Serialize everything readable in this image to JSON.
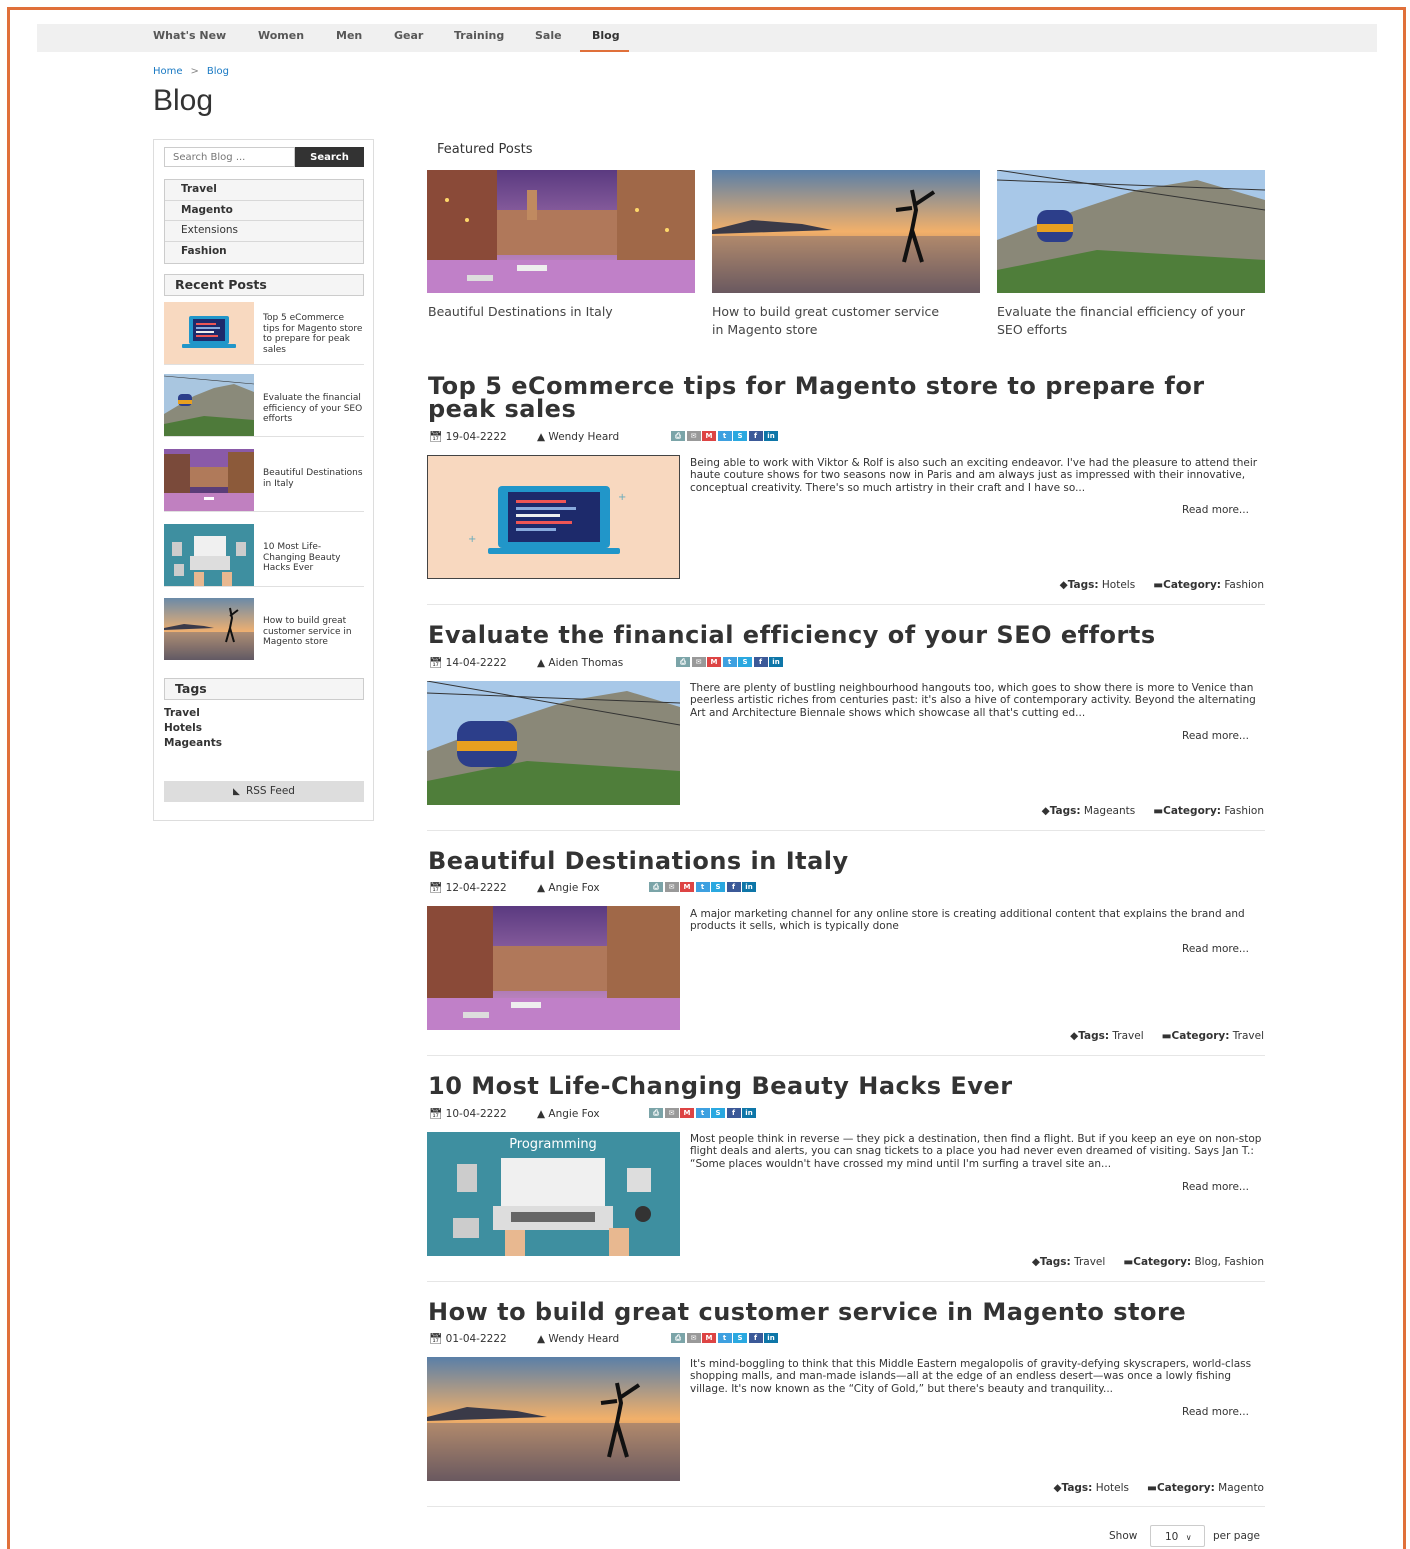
{
  "nav": {
    "items": [
      "What's New",
      "Women",
      "Men",
      "Gear",
      "Training",
      "Sale",
      "Blog"
    ],
    "active": "Blog"
  },
  "breadcrumb": {
    "home": "Home",
    "separator": ">",
    "current": "Blog"
  },
  "page_title": "Blog",
  "sidebar": {
    "search_placeholder": "Search Blog ...",
    "search_button": "Search",
    "categories": [
      "Travel",
      "Magento",
      "Extensions",
      "Fashion"
    ],
    "recent_heading": "Recent Posts",
    "recent_posts": [
      "Top 5 eCommerce tips for Magento store to prepare for peak sales",
      "Evaluate the financial efficiency of your SEO efforts",
      "Beautiful Destinations in Italy",
      "10 Most Life-Changing Beauty Hacks Ever",
      "How to build great customer service in Magento store"
    ],
    "tags_heading": "Tags",
    "tags": [
      "Travel",
      "Hotels",
      "Mageants"
    ],
    "rss": "RSS Feed"
  },
  "featured": {
    "heading": "Featured Posts",
    "items": [
      "Beautiful Destinations in Italy",
      "How to build great customer service in Magento store",
      "Evaluate the financial efficiency of your SEO efforts"
    ]
  },
  "posts": [
    {
      "title": "Top 5 eCommerce tips for Magento store to prepare for peak sales",
      "date": "19-04-2222",
      "author": "Wendy Heard",
      "excerpt": "Being able to work with Viktor & Rolf is also such an exciting endeavor. I've had the pleasure to attend their haute couture shows for two seasons now in Paris and am always just as impressed with their innovative, conceptual creativity. There's so much artistry in their craft and I have so...",
      "read_more": "Read more...",
      "tags_label": "Tags:",
      "tags": "Hotels",
      "category_label": "Category:",
      "category": "Fashion"
    },
    {
      "title": "Evaluate the financial efficiency of your SEO efforts",
      "date": "14-04-2222",
      "author": "Aiden Thomas",
      "excerpt": "There are plenty of bustling neighbourhood hangouts too, which goes to show there is more to Venice than peerless artistic riches from centuries past: it's also a hive of contemporary activity. Beyond the alternating Art and Architecture Biennale shows which showcase all that's cutting ed...",
      "read_more": "Read more...",
      "tags_label": "Tags:",
      "tags": "Mageants",
      "category_label": "Category:",
      "category": "Fashion"
    },
    {
      "title": "Beautiful Destinations in Italy",
      "date": "12-04-2222",
      "author": "Angie Fox",
      "excerpt": "A major marketing channel for any online store is creating additional content that explains the brand and products it sells, which is typically done",
      "read_more": "Read more...",
      "tags_label": "Tags:",
      "tags": "Travel",
      "category_label": "Category:",
      "category": "Travel"
    },
    {
      "title": "10 Most Life-Changing Beauty Hacks Ever",
      "date": "10-04-2222",
      "author": "Angie Fox",
      "excerpt": "Most people think in reverse — they pick a destination, then find a flight. But if you keep an eye on non-stop flight deals and alerts, you can snag tickets to a place you had never even dreamed of visiting. Says Jan T.: “Some places wouldn't have crossed my mind until I'm surfing a travel site an...",
      "read_more": "Read more...",
      "tags_label": "Tags:",
      "tags": "Travel",
      "category_label": "Category:",
      "category": "Blog, Fashion"
    },
    {
      "title": "How to build great customer service in Magento store",
      "date": "01-04-2222",
      "author": "Wendy Heard",
      "excerpt": "It's mind-boggling to think that this Middle Eastern megalopolis of gravity-defying skyscrapers, world-class shopping malls, and man-made islands—all at the edge of an endless desert—was once a lowly fishing village. It's now known as the “City of Gold,” but there's beauty and tranquility...",
      "read_more": "Read more...",
      "tags_label": "Tags:",
      "tags": "Hotels",
      "category_label": "Category:",
      "category": "Magento"
    }
  ],
  "pager": {
    "show": "Show",
    "value": "10",
    "per_page": "per page"
  },
  "programming_image_text": "Programming",
  "colors": {
    "accent": "#e0703a",
    "link": "#1979c3",
    "button_dark": "#333333"
  }
}
